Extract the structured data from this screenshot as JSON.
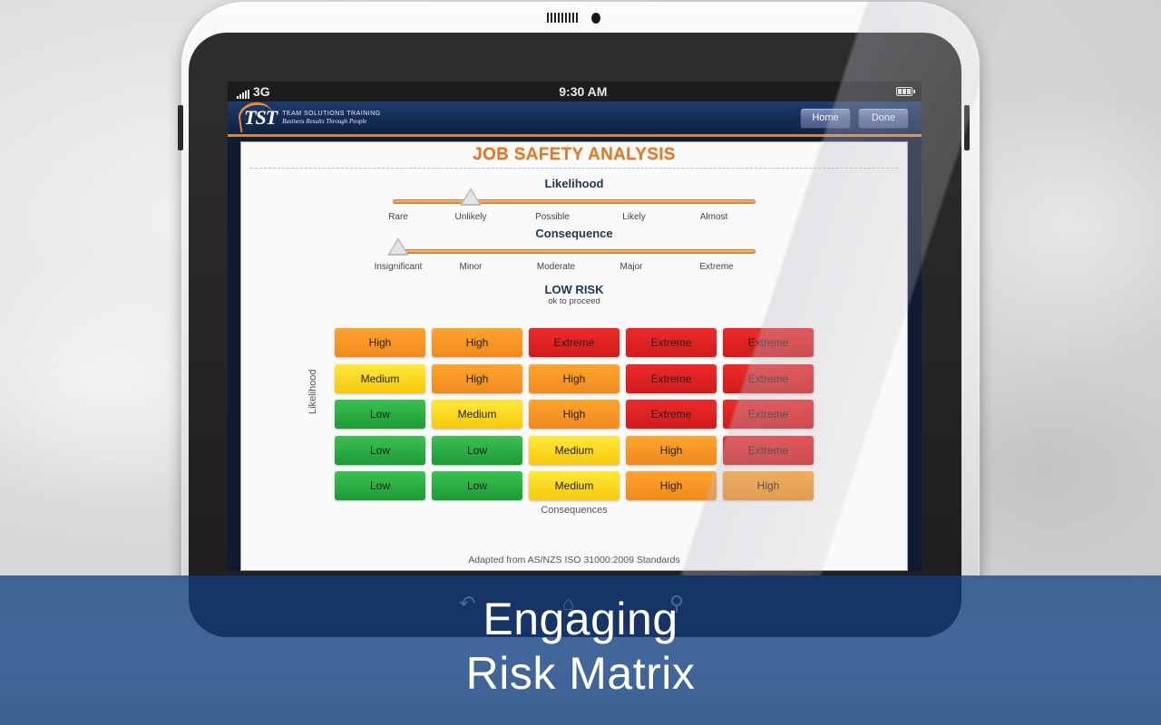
{
  "device": {
    "status_bar": {
      "carrier": "3G",
      "time": "9:30 AM"
    }
  },
  "app": {
    "logo": {
      "mark": "TST",
      "company": "TEAM SOLUTIONS TRAINING",
      "tagline": "Business Results Through People"
    },
    "buttons": {
      "home": "Home",
      "done": "Done"
    },
    "accent_orange": "#e07a2a",
    "header_navy": "#132a52"
  },
  "sheet": {
    "title": "JOB SAFETY ANALYSIS",
    "likelihood": {
      "label": "Likelihood",
      "options": [
        "Rare",
        "Unlikely",
        "Possible",
        "Likely",
        "Almost"
      ],
      "selected_index": 1
    },
    "consequence": {
      "label": "Consequence",
      "options": [
        "Insignificant",
        "Minor",
        "Moderate",
        "Major",
        "Extreme"
      ],
      "selected_index": 0
    },
    "result": {
      "level": "LOW RISK",
      "note": "ok to proceed"
    },
    "matrix": {
      "y_axis_label": "Likelihood",
      "x_axis_label": "Consequences",
      "rows": [
        [
          "High",
          "High",
          "Extreme",
          "Extreme",
          "Extreme"
        ],
        [
          "Medium",
          "High",
          "High",
          "Extreme",
          "Extreme"
        ],
        [
          "Low",
          "Medium",
          "High",
          "Extreme",
          "Extreme"
        ],
        [
          "Low",
          "Low",
          "Medium",
          "High",
          "Extreme"
        ],
        [
          "Low",
          "Low",
          "Medium",
          "High",
          "High"
        ]
      ],
      "colors": {
        "Low": "#1d9a38",
        "Medium": "#f6c90a",
        "High": "#f08a1c",
        "Extreme": "#d01b1b"
      }
    },
    "footer": "Adapted from AS/NZS ISO 31000:2009 Standards"
  },
  "banner": {
    "line1": "Engaging",
    "line2": "Risk Matrix"
  }
}
